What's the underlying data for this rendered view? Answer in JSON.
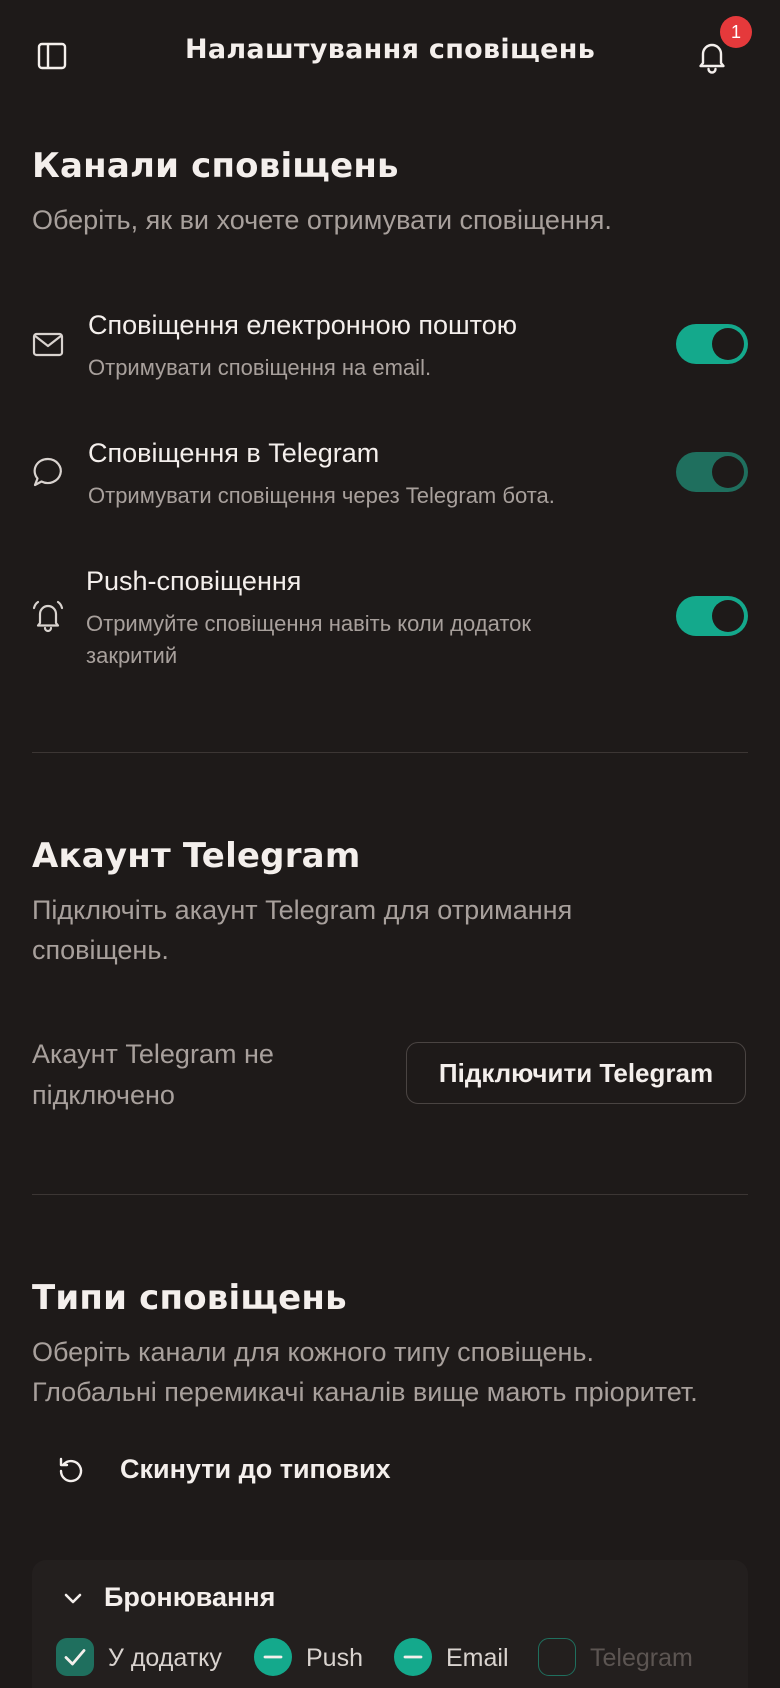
{
  "header": {
    "title": "Налаштування сповіщень",
    "notification_count": "1"
  },
  "channels": {
    "title": "Канали сповіщень",
    "subtitle": "Оберіть, як ви хочете отримувати сповіщення.",
    "items": [
      {
        "title": "Сповіщення електронною поштою",
        "description": "Отримувати сповіщення на email.",
        "enabled": true
      },
      {
        "title": "Сповіщення в Telegram",
        "description": "Отримувати сповіщення через Telegram бота.",
        "enabled": true
      },
      {
        "title": "Push-сповіщення",
        "description_line1": "Отримуйте сповіщення навіть коли додаток",
        "description_line2": "закритий",
        "enabled": true
      }
    ]
  },
  "telegram": {
    "title": "Акаунт Telegram",
    "subtitle_line1": "Підключіть акаунт Telegram для отримання",
    "subtitle_line2": "сповіщень.",
    "status_line1": "Акаунт Telegram не",
    "status_line2": "підключено",
    "connect_label": "Підключити Telegram"
  },
  "types": {
    "title": "Типи сповіщень",
    "subtitle_line1": "Оберіть канали для кожного типу сповіщень.",
    "subtitle_line2": "Глобальні перемикачі каналів вище мають пріоритет.",
    "reset_label": "Скинути до типових",
    "categories": [
      {
        "name": "Бронювання",
        "options": [
          {
            "label": "У додатку",
            "state": "checked"
          },
          {
            "label": "Push",
            "state": "partial"
          },
          {
            "label": "Email",
            "state": "partial"
          },
          {
            "label": "Telegram",
            "state": "unchecked"
          }
        ]
      }
    ]
  },
  "colors": {
    "background": "#1e1a19",
    "accent": "#14a98c",
    "accent_dim": "#1f6f5e",
    "badge": "#e5393b"
  }
}
